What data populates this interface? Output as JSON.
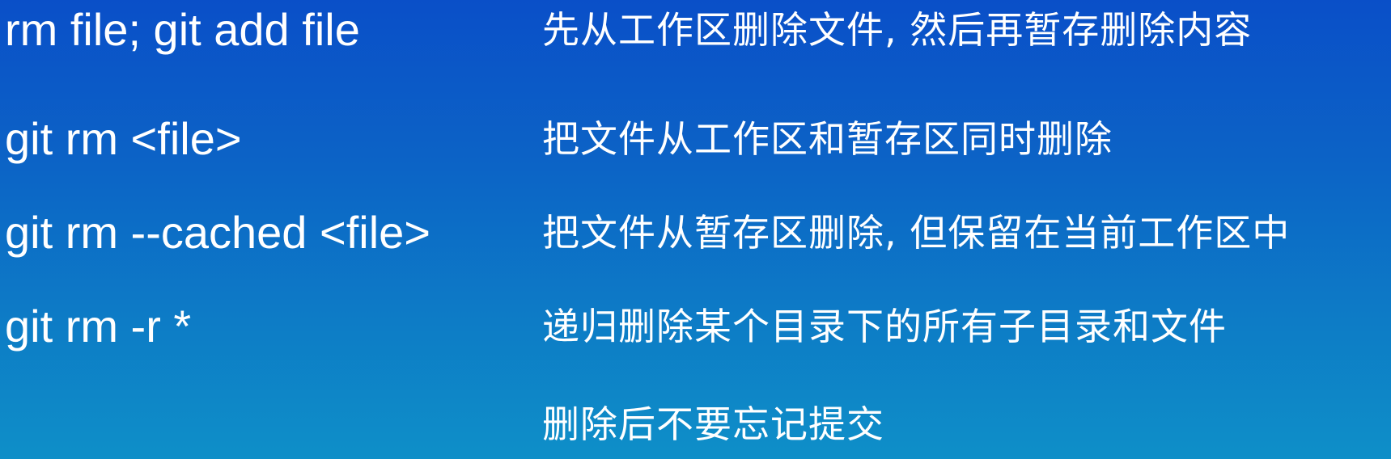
{
  "rows": [
    {
      "command": "rm file; git add file",
      "description": "先从工作区删除文件, 然后再暂存删除内容"
    },
    {
      "command": "git rm <file>",
      "description": "把文件从工作区和暂存区同时删除"
    },
    {
      "command": "git rm --cached <file>",
      "description": "把文件从暂存区删除, 但保留在当前工作区中"
    },
    {
      "command": "git rm -r *",
      "description": "递归删除某个目录下的所有子目录和文件"
    },
    {
      "command": "",
      "description": "删除后不要忘记提交"
    }
  ]
}
